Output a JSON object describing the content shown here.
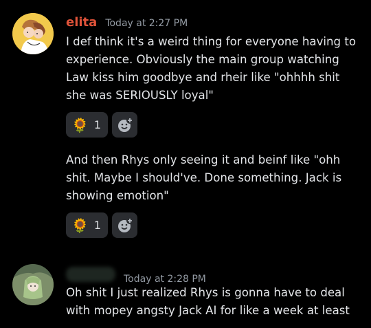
{
  "messages": [
    {
      "username": "elita",
      "username_color": "#e0533a",
      "timestamp": "Today at 2:27 PM",
      "text": "I def think it's a weird thing for everyone having to experience. Obviously the main group watching Law kiss him goodbye and rheir like \"ohhhh shit she was SERIOUSLY loyal\"",
      "reactions": [
        {
          "emoji_icon": "sunflower-icon",
          "count": "1"
        }
      ]
    },
    {
      "text": "And then Rhys only seeing it and beinf like \"ohh shit. Maybe I should've. Done something. Jack is showing emotion\"",
      "reactions": [
        {
          "emoji_icon": "sunflower-icon",
          "count": "1"
        }
      ]
    },
    {
      "timestamp": "Today at 2:28 PM",
      "text": "Oh shit I just realized Rhys is gonna have to deal with mopey angsty Jack AI for like a week at least"
    }
  ]
}
